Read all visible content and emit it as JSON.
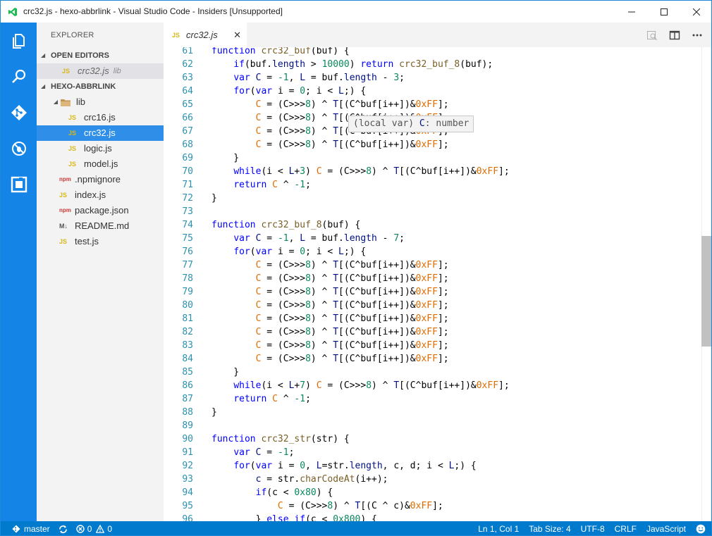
{
  "window": {
    "title": "crc32.js - hexo-abbrlink - Visual Studio Code - Insiders [Unsupported]",
    "minimize_icon": "minimize-icon",
    "maximize_icon": "maximize-icon",
    "close_icon": "close-icon"
  },
  "activity_bar": {
    "items": [
      "explorer-icon",
      "search-icon",
      "git-icon",
      "debug-icon",
      "extensions-icon"
    ]
  },
  "sidebar": {
    "header": "EXPLORER",
    "open_editors_label": "OPEN EDITORS",
    "open_editors": [
      {
        "name": "crc32.js",
        "hint": "lib",
        "icon": "JS"
      }
    ],
    "project_label": "HEXO-ABBRLINK",
    "tree": [
      {
        "name": "lib",
        "type": "folder",
        "depth": 1
      },
      {
        "name": "crc16.js",
        "type": "js",
        "depth": 2
      },
      {
        "name": "crc32.js",
        "type": "js",
        "depth": 2,
        "selected": true
      },
      {
        "name": "logic.js",
        "type": "js",
        "depth": 2
      },
      {
        "name": "model.js",
        "type": "js",
        "depth": 2
      },
      {
        "name": ".npmignore",
        "type": "npm",
        "depth": 1
      },
      {
        "name": "index.js",
        "type": "js",
        "depth": 1
      },
      {
        "name": "package.json",
        "type": "npm",
        "depth": 1
      },
      {
        "name": "README.md",
        "type": "md",
        "depth": 1
      },
      {
        "name": "test.js",
        "type": "js",
        "depth": 1
      }
    ]
  },
  "tabs": [
    {
      "label": "crc32.js",
      "icon": "JS",
      "close": "✕"
    }
  ],
  "editor_actions": [
    "open-preview-icon",
    "split-editor-icon",
    "more-actions-icon"
  ],
  "hover_tooltip": {
    "prefix": "(local var) ",
    "name": "C",
    "rest": ": number"
  },
  "code_lines": [
    {
      "n": "61",
      "tokens": [
        [
          "kw",
          "function "
        ],
        [
          "fn",
          "crc32_buf"
        ],
        [
          "op",
          "(buf) {"
        ]
      ]
    },
    {
      "n": "62",
      "tokens": [
        [
          "op",
          "    "
        ],
        [
          "kw",
          "if"
        ],
        [
          "op",
          "(buf."
        ],
        [
          "var",
          "length"
        ],
        [
          "op",
          " > "
        ],
        [
          "num",
          "10000"
        ],
        [
          "op",
          ") "
        ],
        [
          "kw",
          "return "
        ],
        [
          "fn",
          "crc32_buf_8"
        ],
        [
          "op",
          "(buf);"
        ]
      ]
    },
    {
      "n": "63",
      "tokens": [
        [
          "op",
          "    "
        ],
        [
          "kw",
          "var "
        ],
        [
          "var",
          "C"
        ],
        [
          "op",
          " = "
        ],
        [
          "num",
          "-1"
        ],
        [
          "op",
          ", "
        ],
        [
          "var",
          "L"
        ],
        [
          "op",
          " = buf."
        ],
        [
          "var",
          "length"
        ],
        [
          "op",
          " - "
        ],
        [
          "num",
          "3"
        ],
        [
          "op",
          ";"
        ]
      ]
    },
    {
      "n": "64",
      "tokens": [
        [
          "op",
          "    "
        ],
        [
          "kw",
          "for"
        ],
        [
          "op",
          "("
        ],
        [
          "kw",
          "var "
        ],
        [
          "op",
          "i = "
        ],
        [
          "num",
          "0"
        ],
        [
          "op",
          "; i < "
        ],
        [
          "var",
          "L"
        ],
        [
          "op",
          ";) {"
        ]
      ]
    },
    {
      "n": "65",
      "tokens": [
        [
          "op",
          "        "
        ],
        [
          "hex",
          "C"
        ],
        [
          "op",
          " = (C>>>"
        ],
        [
          "num",
          "8"
        ],
        [
          "op",
          ") ^ "
        ],
        [
          "var",
          "T"
        ],
        [
          "op",
          "[(C^buf[i++])&"
        ],
        [
          "hex",
          "0xFF"
        ],
        [
          "op",
          "];"
        ]
      ]
    },
    {
      "n": "66",
      "tokens": [
        [
          "op",
          "        "
        ],
        [
          "hex",
          "C"
        ],
        [
          "op",
          " = (C>>>"
        ],
        [
          "num",
          "8"
        ],
        [
          "op",
          ") ^ "
        ],
        [
          "var",
          "T"
        ],
        [
          "op",
          "[(C^buf[i++])&"
        ],
        [
          "hex",
          "0xFF"
        ],
        [
          "op",
          "];"
        ]
      ]
    },
    {
      "n": "67",
      "tokens": [
        [
          "op",
          "        "
        ],
        [
          "hex",
          "C"
        ],
        [
          "op",
          " = (C>>>"
        ],
        [
          "num",
          "8"
        ],
        [
          "op",
          ") ^ "
        ],
        [
          "var",
          "T"
        ],
        [
          "op",
          "[(C^buf[i++])&"
        ],
        [
          "hex",
          "0xFF"
        ],
        [
          "op",
          "];"
        ]
      ]
    },
    {
      "n": "68",
      "tokens": [
        [
          "op",
          "        "
        ],
        [
          "hex",
          "C"
        ],
        [
          "op",
          " = (C>>>"
        ],
        [
          "num",
          "8"
        ],
        [
          "op",
          ") ^ "
        ],
        [
          "var",
          "T"
        ],
        [
          "op",
          "[(C^buf[i++])&"
        ],
        [
          "hex",
          "0xFF"
        ],
        [
          "op",
          "];"
        ]
      ]
    },
    {
      "n": "69",
      "tokens": [
        [
          "op",
          "    }"
        ]
      ]
    },
    {
      "n": "70",
      "tokens": [
        [
          "op",
          "    "
        ],
        [
          "kw",
          "while"
        ],
        [
          "op",
          "(i < "
        ],
        [
          "var",
          "L"
        ],
        [
          "op",
          "+"
        ],
        [
          "num",
          "3"
        ],
        [
          "op",
          ") "
        ],
        [
          "hex",
          "C"
        ],
        [
          "op",
          " = (C>>>"
        ],
        [
          "num",
          "8"
        ],
        [
          "op",
          ") ^ "
        ],
        [
          "var",
          "T"
        ],
        [
          "op",
          "[(C^buf[i++])&"
        ],
        [
          "hex",
          "0xFF"
        ],
        [
          "op",
          "];"
        ]
      ]
    },
    {
      "n": "71",
      "tokens": [
        [
          "op",
          "    "
        ],
        [
          "kw",
          "return "
        ],
        [
          "hex",
          "C"
        ],
        [
          "op",
          " ^ "
        ],
        [
          "num",
          "-1"
        ],
        [
          "op",
          ";"
        ]
      ]
    },
    {
      "n": "72",
      "tokens": [
        [
          "op",
          "}"
        ]
      ]
    },
    {
      "n": "73",
      "tokens": []
    },
    {
      "n": "74",
      "tokens": [
        [
          "kw",
          "function "
        ],
        [
          "fn",
          "crc32_buf_8"
        ],
        [
          "op",
          "(buf) {"
        ]
      ]
    },
    {
      "n": "75",
      "tokens": [
        [
          "op",
          "    "
        ],
        [
          "kw",
          "var "
        ],
        [
          "var",
          "C"
        ],
        [
          "op",
          " = "
        ],
        [
          "num",
          "-1"
        ],
        [
          "op",
          ", "
        ],
        [
          "var",
          "L"
        ],
        [
          "op",
          " = buf."
        ],
        [
          "var",
          "length"
        ],
        [
          "op",
          " - "
        ],
        [
          "num",
          "7"
        ],
        [
          "op",
          ";"
        ]
      ]
    },
    {
      "n": "76",
      "tokens": [
        [
          "op",
          "    "
        ],
        [
          "kw",
          "for"
        ],
        [
          "op",
          "("
        ],
        [
          "kw",
          "var "
        ],
        [
          "op",
          "i = "
        ],
        [
          "num",
          "0"
        ],
        [
          "op",
          "; i < "
        ],
        [
          "var",
          "L"
        ],
        [
          "op",
          ";) {"
        ]
      ]
    },
    {
      "n": "77",
      "tokens": [
        [
          "op",
          "        "
        ],
        [
          "hex",
          "C"
        ],
        [
          "op",
          " = (C>>>"
        ],
        [
          "num",
          "8"
        ],
        [
          "op",
          ") ^ "
        ],
        [
          "var",
          "T"
        ],
        [
          "op",
          "[(C^buf[i++])&"
        ],
        [
          "hex",
          "0xFF"
        ],
        [
          "op",
          "];"
        ]
      ]
    },
    {
      "n": "78",
      "tokens": [
        [
          "op",
          "        "
        ],
        [
          "hex",
          "C"
        ],
        [
          "op",
          " = (C>>>"
        ],
        [
          "num",
          "8"
        ],
        [
          "op",
          ") ^ "
        ],
        [
          "var",
          "T"
        ],
        [
          "op",
          "[(C^buf[i++])&"
        ],
        [
          "hex",
          "0xFF"
        ],
        [
          "op",
          "];"
        ]
      ]
    },
    {
      "n": "79",
      "tokens": [
        [
          "op",
          "        "
        ],
        [
          "hex",
          "C"
        ],
        [
          "op",
          " = (C>>>"
        ],
        [
          "num",
          "8"
        ],
        [
          "op",
          ") ^ "
        ],
        [
          "var",
          "T"
        ],
        [
          "op",
          "[(C^buf[i++])&"
        ],
        [
          "hex",
          "0xFF"
        ],
        [
          "op",
          "];"
        ]
      ]
    },
    {
      "n": "80",
      "tokens": [
        [
          "op",
          "        "
        ],
        [
          "hex",
          "C"
        ],
        [
          "op",
          " = (C>>>"
        ],
        [
          "num",
          "8"
        ],
        [
          "op",
          ") ^ "
        ],
        [
          "var",
          "T"
        ],
        [
          "op",
          "[(C^buf[i++])&"
        ],
        [
          "hex",
          "0xFF"
        ],
        [
          "op",
          "];"
        ]
      ]
    },
    {
      "n": "81",
      "tokens": [
        [
          "op",
          "        "
        ],
        [
          "hex",
          "C"
        ],
        [
          "op",
          " = (C>>>"
        ],
        [
          "num",
          "8"
        ],
        [
          "op",
          ") ^ "
        ],
        [
          "var",
          "T"
        ],
        [
          "op",
          "[(C^buf[i++])&"
        ],
        [
          "hex",
          "0xFF"
        ],
        [
          "op",
          "];"
        ]
      ]
    },
    {
      "n": "82",
      "tokens": [
        [
          "op",
          "        "
        ],
        [
          "hex",
          "C"
        ],
        [
          "op",
          " = (C>>>"
        ],
        [
          "num",
          "8"
        ],
        [
          "op",
          ") ^ "
        ],
        [
          "var",
          "T"
        ],
        [
          "op",
          "[(C^buf[i++])&"
        ],
        [
          "hex",
          "0xFF"
        ],
        [
          "op",
          "];"
        ]
      ]
    },
    {
      "n": "83",
      "tokens": [
        [
          "op",
          "        "
        ],
        [
          "hex",
          "C"
        ],
        [
          "op",
          " = (C>>>"
        ],
        [
          "num",
          "8"
        ],
        [
          "op",
          ") ^ "
        ],
        [
          "var",
          "T"
        ],
        [
          "op",
          "[(C^buf[i++])&"
        ],
        [
          "hex",
          "0xFF"
        ],
        [
          "op",
          "];"
        ]
      ]
    },
    {
      "n": "84",
      "tokens": [
        [
          "op",
          "        "
        ],
        [
          "hex",
          "C"
        ],
        [
          "op",
          " = (C>>>"
        ],
        [
          "num",
          "8"
        ],
        [
          "op",
          ") ^ "
        ],
        [
          "var",
          "T"
        ],
        [
          "op",
          "[(C^buf[i++])&"
        ],
        [
          "hex",
          "0xFF"
        ],
        [
          "op",
          "];"
        ]
      ]
    },
    {
      "n": "85",
      "tokens": [
        [
          "op",
          "    }"
        ]
      ]
    },
    {
      "n": "86",
      "tokens": [
        [
          "op",
          "    "
        ],
        [
          "kw",
          "while"
        ],
        [
          "op",
          "(i < "
        ],
        [
          "var",
          "L"
        ],
        [
          "op",
          "+"
        ],
        [
          "num",
          "7"
        ],
        [
          "op",
          ") "
        ],
        [
          "hex",
          "C"
        ],
        [
          "op",
          " = (C>>>"
        ],
        [
          "num",
          "8"
        ],
        [
          "op",
          ") ^ "
        ],
        [
          "var",
          "T"
        ],
        [
          "op",
          "[(C^buf[i++])&"
        ],
        [
          "hex",
          "0xFF"
        ],
        [
          "op",
          "];"
        ]
      ]
    },
    {
      "n": "87",
      "tokens": [
        [
          "op",
          "    "
        ],
        [
          "kw",
          "return "
        ],
        [
          "hex",
          "C"
        ],
        [
          "op",
          " ^ "
        ],
        [
          "num",
          "-1"
        ],
        [
          "op",
          ";"
        ]
      ]
    },
    {
      "n": "88",
      "tokens": [
        [
          "op",
          "}"
        ]
      ]
    },
    {
      "n": "89",
      "tokens": []
    },
    {
      "n": "90",
      "tokens": [
        [
          "kw",
          "function "
        ],
        [
          "fn",
          "crc32_str"
        ],
        [
          "op",
          "(str) {"
        ]
      ]
    },
    {
      "n": "91",
      "tokens": [
        [
          "op",
          "    "
        ],
        [
          "kw",
          "var "
        ],
        [
          "var",
          "C"
        ],
        [
          "op",
          " = "
        ],
        [
          "num",
          "-1"
        ],
        [
          "op",
          ";"
        ]
      ]
    },
    {
      "n": "92",
      "tokens": [
        [
          "op",
          "    "
        ],
        [
          "kw",
          "for"
        ],
        [
          "op",
          "("
        ],
        [
          "kw",
          "var "
        ],
        [
          "op",
          "i = "
        ],
        [
          "num",
          "0"
        ],
        [
          "op",
          ", "
        ],
        [
          "var",
          "L"
        ],
        [
          "op",
          "=str."
        ],
        [
          "var",
          "length"
        ],
        [
          "op",
          ", c, d; i < "
        ],
        [
          "var",
          "L"
        ],
        [
          "op",
          ";) {"
        ]
      ]
    },
    {
      "n": "93",
      "tokens": [
        [
          "op",
          "        "
        ],
        [
          "var",
          "c"
        ],
        [
          "op",
          " = str."
        ],
        [
          "fn",
          "charCodeAt"
        ],
        [
          "op",
          "(i++);"
        ]
      ]
    },
    {
      "n": "94",
      "tokens": [
        [
          "op",
          "        "
        ],
        [
          "kw",
          "if"
        ],
        [
          "op",
          "(c < "
        ],
        [
          "num",
          "0x80"
        ],
        [
          "op",
          ") {"
        ]
      ]
    },
    {
      "n": "95",
      "tokens": [
        [
          "op",
          "            "
        ],
        [
          "hex",
          "C"
        ],
        [
          "op",
          " = (C>>>"
        ],
        [
          "num",
          "8"
        ],
        [
          "op",
          ") ^ "
        ],
        [
          "var",
          "T"
        ],
        [
          "op",
          "[(C ^ c)&"
        ],
        [
          "hex",
          "0xFF"
        ],
        [
          "op",
          "];"
        ]
      ]
    },
    {
      "n": "96",
      "tokens": [
        [
          "op",
          "        } "
        ],
        [
          "kw",
          "else if"
        ],
        [
          "op",
          "(c < "
        ],
        [
          "num",
          "0x800"
        ],
        [
          "op",
          ") {"
        ]
      ]
    }
  ],
  "status_bar": {
    "branch": "master",
    "errors": "0",
    "warnings": "0",
    "position": "Ln 1, Col 1",
    "tab_size": "Tab Size: 4",
    "encoding": "UTF-8",
    "eol": "CRLF",
    "language": "JavaScript"
  },
  "colors": {
    "activity_bar": "#1484e6",
    "status_bar": "#007acc",
    "selection": "#2f8fe8"
  }
}
